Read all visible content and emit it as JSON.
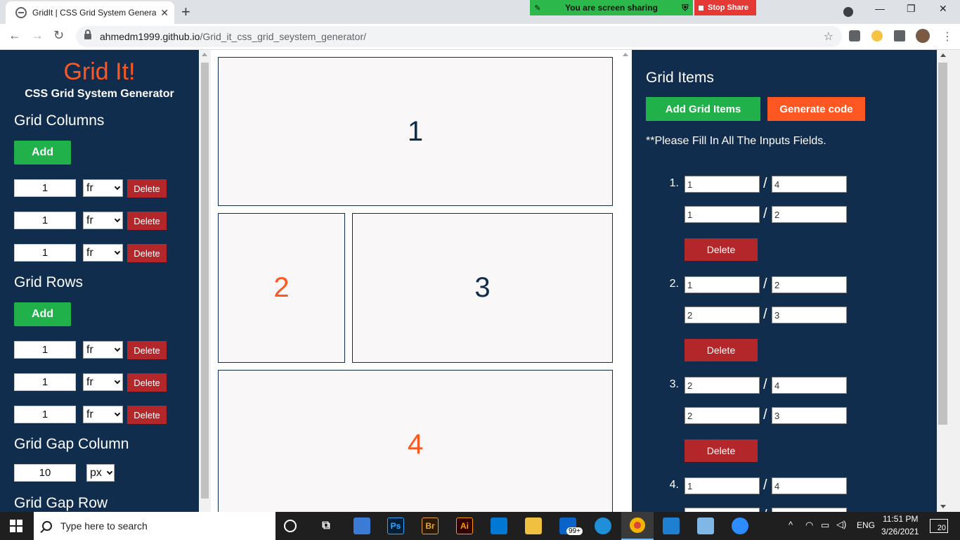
{
  "browser": {
    "tab_title": "GridIt | CSS Grid System Generator",
    "tab_close": "✕",
    "new_tab": "+",
    "url_domain": "ahmedm1999.github.io",
    "url_path": "/Grid_it_css_grid_seystem_generator/",
    "win_min": "—",
    "win_restore": "❐",
    "win_close": "✕"
  },
  "screen_share": {
    "message": "You are screen sharing",
    "stop_label": "Stop Share"
  },
  "sidebar": {
    "logo": "Grid It!",
    "subtitle": "CSS Grid System Generator",
    "columns_title": "Grid Columns",
    "rows_title": "Grid Rows",
    "add_label": "Add",
    "delete_label": "Delete",
    "columns": [
      {
        "value": "1",
        "unit": "fr"
      },
      {
        "value": "1",
        "unit": "fr"
      },
      {
        "value": "1",
        "unit": "fr"
      }
    ],
    "rows": [
      {
        "value": "1",
        "unit": "fr"
      },
      {
        "value": "1",
        "unit": "fr"
      },
      {
        "value": "1",
        "unit": "fr"
      }
    ],
    "gap_column_title": "Grid Gap Column",
    "gap_column_value": "10",
    "gap_column_unit": "px",
    "gap_row_title": "Grid Gap Row"
  },
  "preview": {
    "cells": [
      {
        "label": "1",
        "color": "#112d4e"
      },
      {
        "label": "2",
        "color": "#ff5722"
      },
      {
        "label": "3",
        "color": "#112d4e"
      },
      {
        "label": "4",
        "color": "#ff5722"
      }
    ]
  },
  "right_panel": {
    "title": "Grid Items",
    "add_items_label": "Add Grid Items",
    "generate_label": "Generate code",
    "note": "**Please Fill In All The Inputs Fields.",
    "delete_label": "Delete",
    "slash": "/",
    "items": [
      {
        "num": "1.",
        "row_start": "1",
        "row_end": "4",
        "col_start": "1",
        "col_end": "2"
      },
      {
        "num": "2.",
        "row_start": "1",
        "row_end": "2",
        "col_start": "2",
        "col_end": "3"
      },
      {
        "num": "3.",
        "row_start": "2",
        "row_end": "4",
        "col_start": "2",
        "col_end": "3"
      },
      {
        "num": "4.",
        "row_start": "1",
        "row_end": "4"
      }
    ]
  },
  "taskbar": {
    "search_placeholder": "Type here to search",
    "mail_badge": "99+",
    "language": "ENG",
    "time": "11:51 PM",
    "date": "3/26/2021",
    "notifications": "20",
    "ps": "Ps",
    "br": "Br",
    "ai": "Ai"
  },
  "colors": {
    "navy": "#112d4e",
    "orange": "#ff5722",
    "green": "#21b14a",
    "red": "#b3262a"
  }
}
